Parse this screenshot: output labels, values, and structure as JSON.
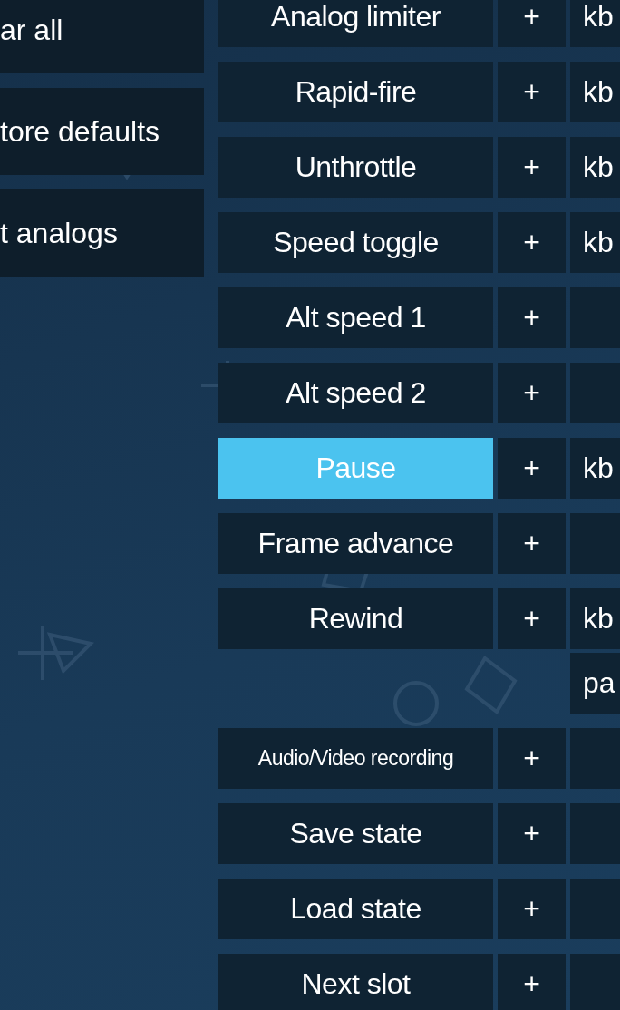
{
  "side_buttons": [
    {
      "label": "ar all"
    },
    {
      "label": "tore defaults"
    },
    {
      "label": "t analogs"
    }
  ],
  "rows": [
    {
      "label": "Analog limiter",
      "selected": false,
      "add": "+",
      "mappings": [
        "kb"
      ]
    },
    {
      "label": "Rapid-fire",
      "selected": false,
      "add": "+",
      "mappings": [
        "kb"
      ]
    },
    {
      "label": "Unthrottle",
      "selected": false,
      "add": "+",
      "mappings": [
        "kb"
      ]
    },
    {
      "label": "Speed toggle",
      "selected": false,
      "add": "+",
      "mappings": [
        "kb"
      ]
    },
    {
      "label": "Alt speed 1",
      "selected": false,
      "add": "+"
    },
    {
      "label": "Alt speed 2",
      "selected": false,
      "add": "+"
    },
    {
      "label": "Pause",
      "selected": true,
      "add": "+",
      "mappings": [
        "kb"
      ]
    },
    {
      "label": "Frame advance",
      "selected": false,
      "add": "+"
    },
    {
      "label": "Rewind",
      "selected": false,
      "add": "+",
      "mappings": [
        "kb",
        "pa"
      ]
    },
    {
      "label": "Audio/Video recording",
      "selected": false,
      "add": "+"
    },
    {
      "label": "Save state",
      "selected": false,
      "add": "+"
    },
    {
      "label": "Load state",
      "selected": false,
      "add": "+"
    },
    {
      "label": "Next slot",
      "selected": false,
      "add": "+"
    }
  ]
}
